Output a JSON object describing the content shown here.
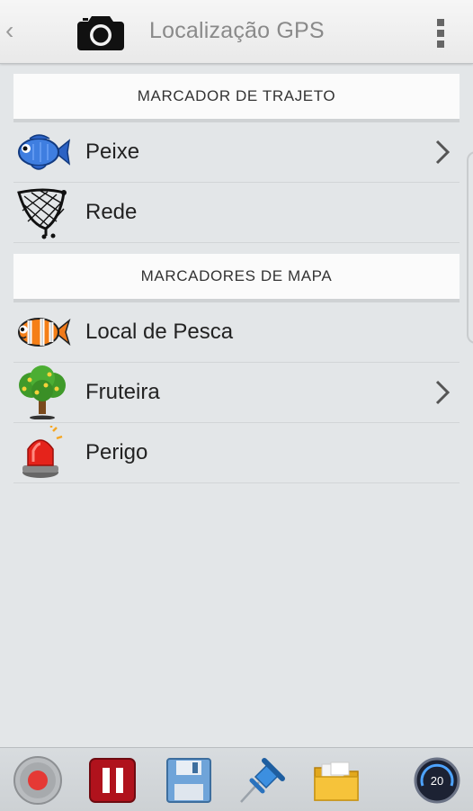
{
  "header": {
    "back_glyph": "‹",
    "title": "Localização GPS",
    "camera_icon": "camera-icon",
    "menu_icon": "overflow-menu-icon"
  },
  "sections": [
    {
      "title": "MARCADOR DE TRAJETO",
      "items": [
        {
          "label": "Peixe",
          "icon": "blue-fish-icon",
          "has_submenu": true
        },
        {
          "label": "Rede",
          "icon": "fishing-net-icon",
          "has_submenu": false
        }
      ]
    },
    {
      "title": "MARCADORES DE MAPA",
      "items": [
        {
          "label": "Local de Pesca",
          "icon": "clownfish-icon",
          "has_submenu": false
        },
        {
          "label": "Fruteira",
          "icon": "fruit-tree-icon",
          "has_submenu": true
        },
        {
          "label": "Perigo",
          "icon": "red-siren-icon",
          "has_submenu": false
        }
      ]
    }
  ],
  "toolbar": {
    "items": [
      "record-button",
      "pause-button",
      "save-button",
      "pin-button",
      "folder-button",
      "speedometer-button"
    ],
    "speed_value": "20"
  },
  "colors": {
    "background": "#e3e6e8",
    "header_bg": "#f2f2f2",
    "pause_red": "#b0121c",
    "folder_yellow": "#f6c33a"
  }
}
